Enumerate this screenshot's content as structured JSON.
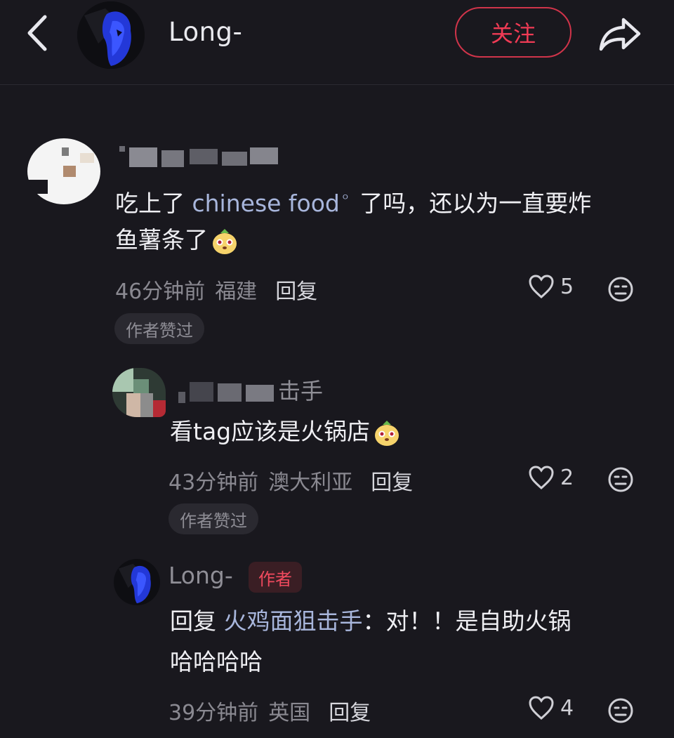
{
  "header": {
    "author_name": "Long-",
    "follow_label": "关注",
    "back_icon": "chevron-left-icon",
    "share_icon": "share-arrow-icon"
  },
  "colors": {
    "background": "#19181e",
    "accent_red": "#f03b55",
    "link_blue": "#a8b6dc",
    "meta_gray": "#8a8991"
  },
  "comments": [
    {
      "text_before": "吃上了 ",
      "link_text": "chinese food",
      "text_after": " 了吗，还以为一直要炸",
      "text_line2": "鱼薯条了",
      "time": "46分钟前",
      "location": "福建",
      "reply_label": "回复",
      "likes": "5",
      "author_liked": "作者赞过"
    },
    {
      "name_visible": "击手",
      "text": "看tag应该是火锅店",
      "time": "43分钟前",
      "location": "澳大利亚",
      "reply_label": "回复",
      "likes": "2",
      "author_liked": "作者赞过"
    },
    {
      "name": "Long-",
      "author_tag": "作者",
      "reply_prefix": "回复 ",
      "mention": "火鸡面狙击手",
      "text_after": "：对！！是自助火锅",
      "text_line2": "哈哈哈哈",
      "time": "39分钟前",
      "location": "英国",
      "reply_label": "回复",
      "likes": "4"
    }
  ]
}
